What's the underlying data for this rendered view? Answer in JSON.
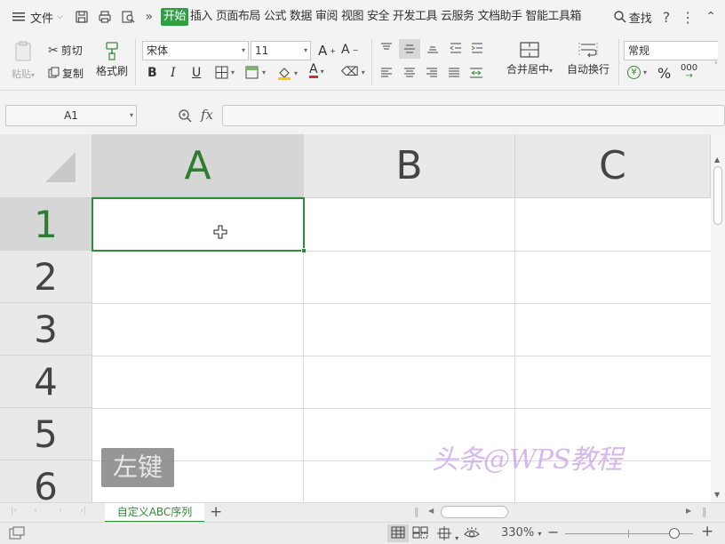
{
  "menubar": {
    "file_label": "文件",
    "tabs": [
      "开始",
      "插入",
      "页面布局",
      "公式",
      "数据",
      "审阅",
      "视图",
      "安全",
      "开发工具",
      "云服务",
      "文档助手",
      "智能工具箱"
    ],
    "active_tab": "开始",
    "search_label": "查找",
    "accent_color": "#2f9e44"
  },
  "ribbon": {
    "paste_label": "粘贴",
    "cut_label": "剪切",
    "copy_label": "复制",
    "format_painter_label": "格式刷",
    "font_name": "宋体",
    "font_size": "11",
    "merge_label": "合并居中",
    "wrap_label": "自动换行",
    "number_format": "常规",
    "bold": "B",
    "italic": "I",
    "underline": "U",
    "percent": "%",
    "thousands": "000"
  },
  "formula": {
    "name_box": "A1",
    "fx_label": "fx",
    "value": ""
  },
  "sheet": {
    "columns": [
      "A",
      "B",
      "C"
    ],
    "rows": [
      "1",
      "2",
      "3",
      "4",
      "5",
      "6"
    ],
    "active_cell": "A1",
    "accent_color": "#2e8b36"
  },
  "overlay": {
    "badge_text": "左键",
    "watermark_text": "头条@WPS教程"
  },
  "tabbar": {
    "sheet_name": "自定义ABC序列",
    "add_label": "+"
  },
  "statusbar": {
    "zoom": "330%",
    "zoom_minus": "−",
    "zoom_plus": "+"
  }
}
